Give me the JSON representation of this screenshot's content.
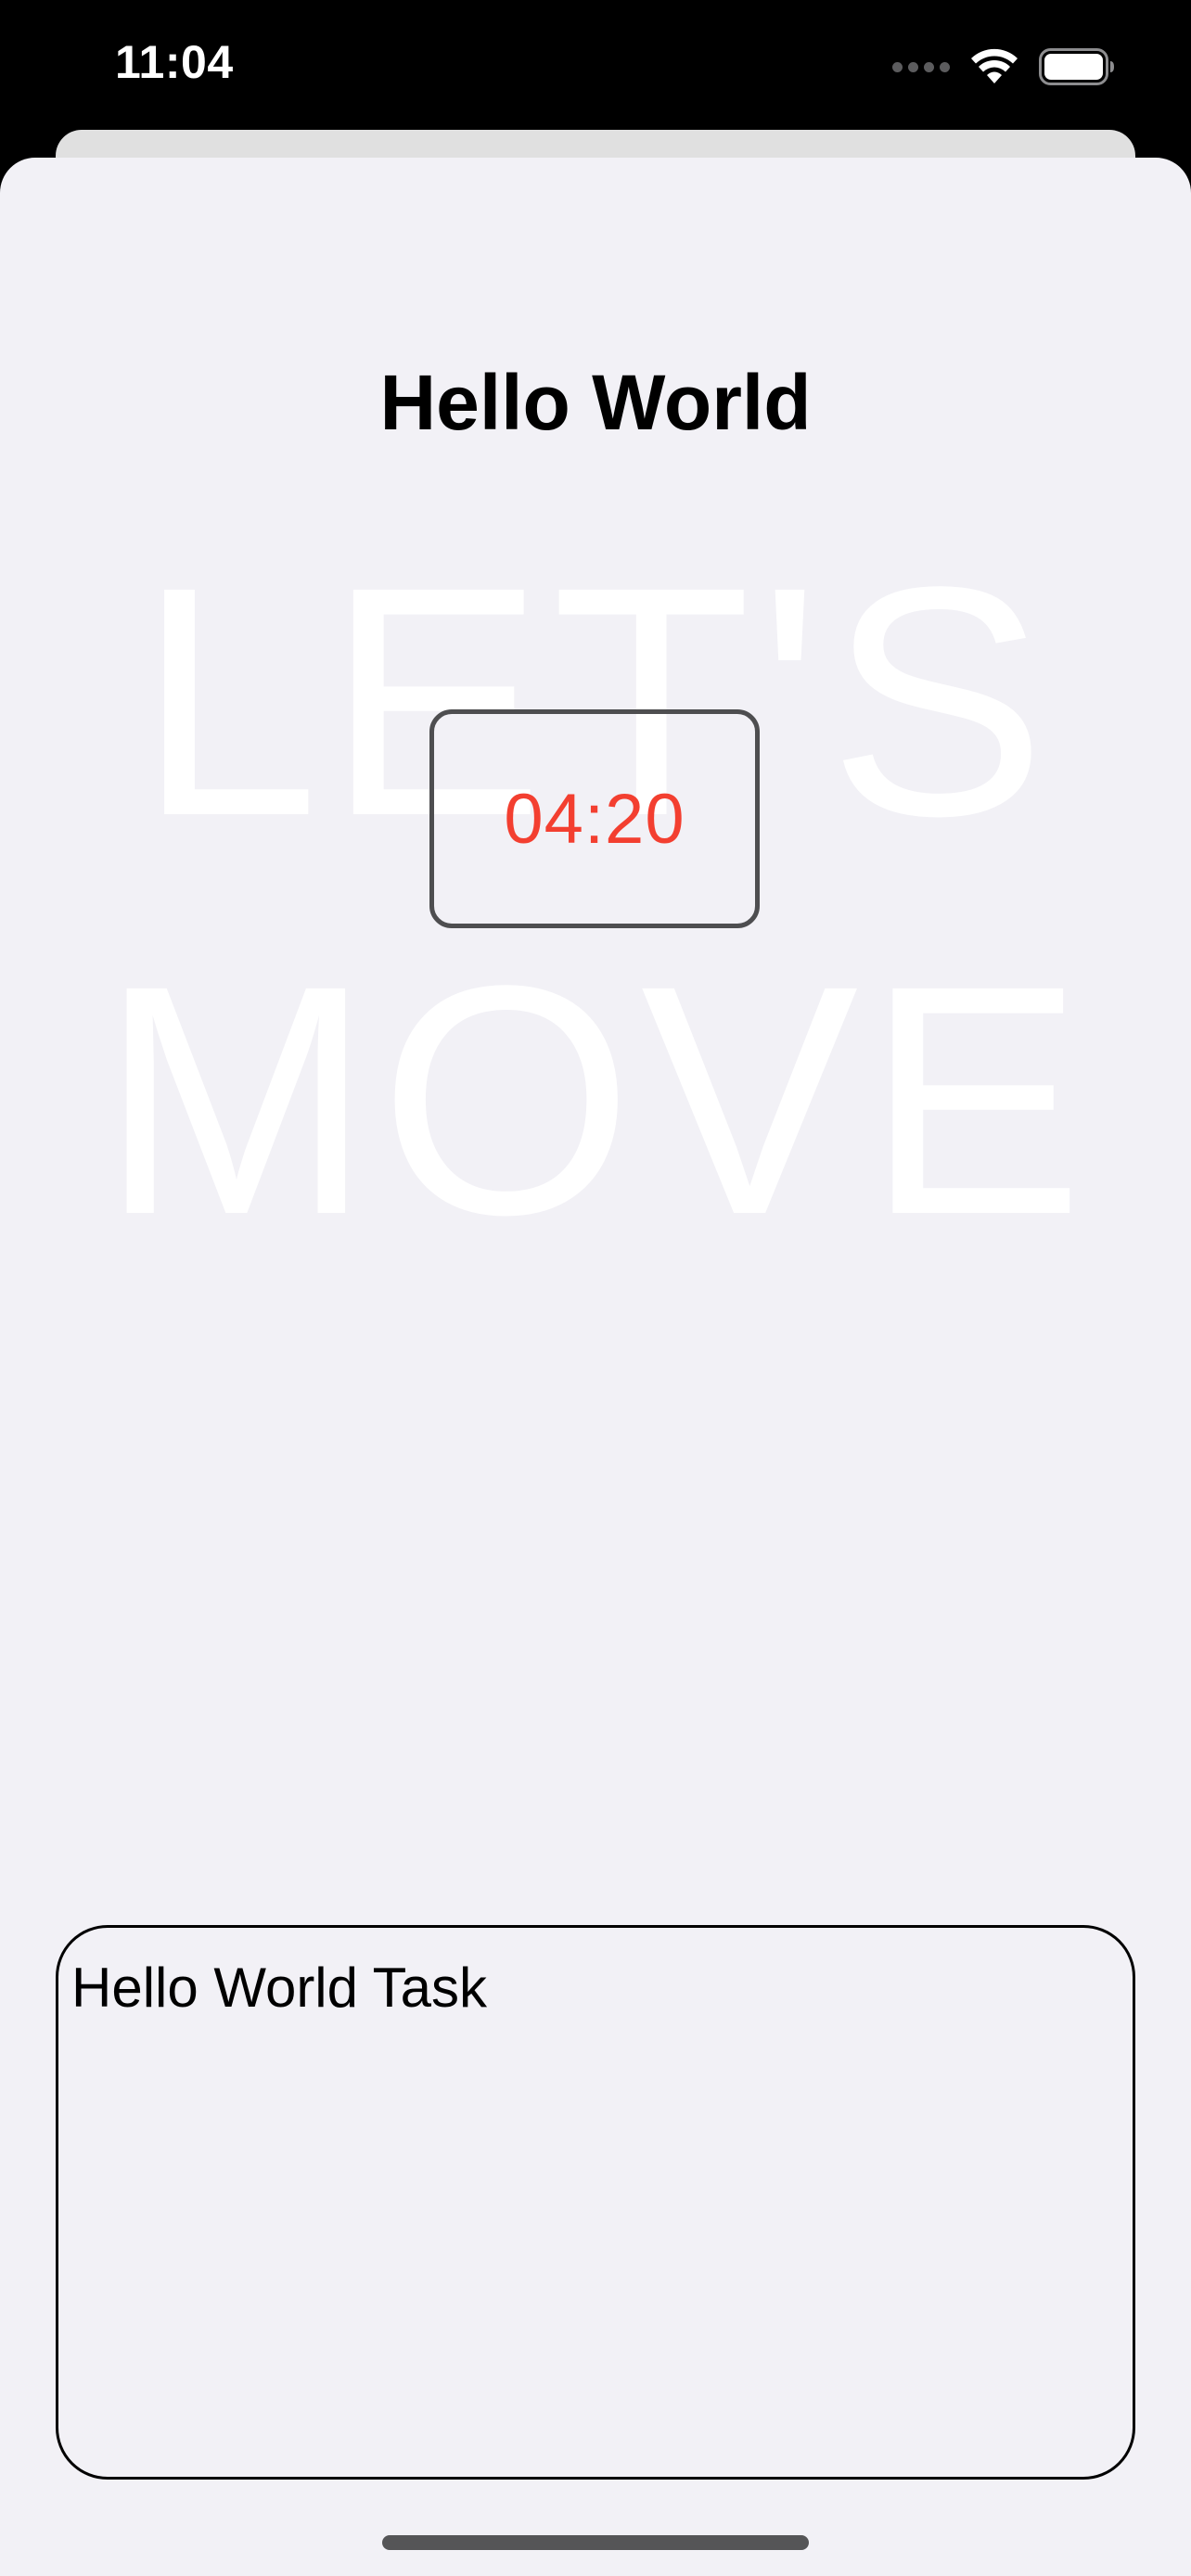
{
  "status_bar": {
    "time": "11:04",
    "icons": [
      "signal-icon",
      "wifi-icon",
      "battery-icon"
    ]
  },
  "screen": {
    "title": "Hello World",
    "background_text_line1": "LET'S",
    "background_text_line2": "MOVE",
    "timer": "04:20",
    "timer_color": "#f33f30"
  },
  "task_card": {
    "title": "Hello World Task"
  },
  "colors": {
    "sheet_background": "#f2f1f6",
    "status_bar_background": "#000000"
  }
}
